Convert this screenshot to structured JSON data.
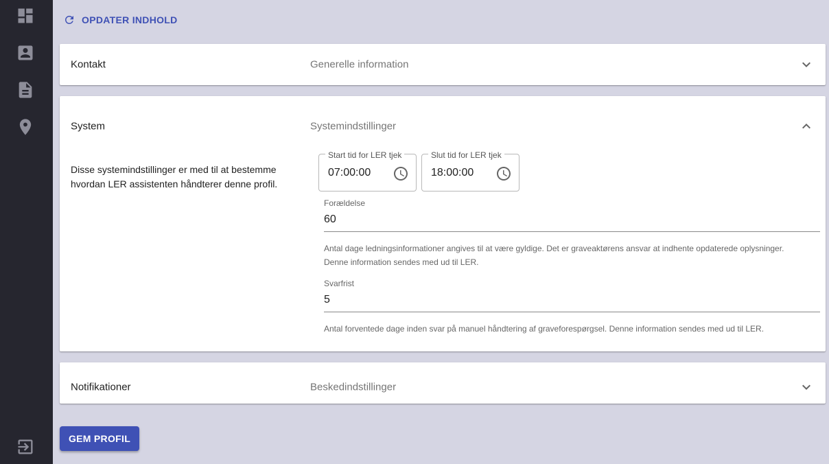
{
  "sidebar": {
    "items": [
      {
        "icon": "dashboard-icon"
      },
      {
        "icon": "contact-card-icon"
      },
      {
        "icon": "document-icon"
      },
      {
        "icon": "location-pin-icon"
      }
    ],
    "logout_icon": "logout-icon"
  },
  "toolbar": {
    "refresh_label": "OPDATER INDHOLD",
    "refresh_icon": "refresh-icon"
  },
  "panels": {
    "contact": {
      "title": "Kontakt",
      "subtitle": "Generelle information",
      "expanded": false
    },
    "system": {
      "title": "System",
      "subtitle": "Systemindstillinger",
      "expanded": true,
      "description_line1": "Disse systemindstillinger er med til at bestemme",
      "description_line2": "hvordan LER assistenten håndterer denne profil.",
      "start_time": {
        "label": "Start tid for LER tjek",
        "value": "07:00:00"
      },
      "end_time": {
        "label": "Slut tid for LER tjek",
        "value": "18:00:00"
      },
      "expiry": {
        "label": "Forældelse",
        "value": "60",
        "help_line1": "Antal dage ledningsinformationer angives til at være gyldige. Det er graveaktørens ansvar at indhente opdaterede oplysninger.",
        "help_line2": "Denne information sendes med ud til LER."
      },
      "deadline": {
        "label": "Svarfrist",
        "value": "5",
        "help_line1": "Antal forventede dage inden svar på manuel håndtering af graveforespørgsel. Denne information sendes med ud til LER."
      }
    },
    "notifications": {
      "title": "Notifikationer",
      "subtitle": "Beskedindstillinger",
      "expanded": false
    }
  },
  "actions": {
    "save_label": "GEM PROFIL"
  },
  "colors": {
    "accent": "#3f51b5",
    "sidebar": "#26262f",
    "background": "#d5d5e3"
  }
}
